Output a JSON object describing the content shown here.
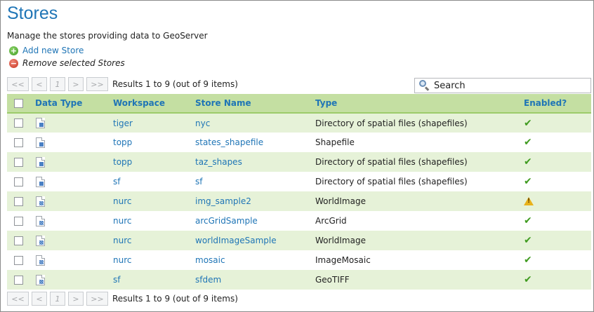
{
  "page": {
    "title": "Stores",
    "description": "Manage the stores providing data to GeoServer",
    "add_store_label": "Add new Store",
    "remove_stores_label": "Remove selected Stores"
  },
  "pager": {
    "first": "<<",
    "prev": "<",
    "current": "1",
    "next": ">",
    "last": ">>",
    "results": "Results 1 to 9 (out of 9 items)"
  },
  "search": {
    "placeholder": "Search"
  },
  "table": {
    "headers": {
      "data_type": "Data Type",
      "workspace": "Workspace",
      "store_name": "Store Name",
      "type": "Type",
      "enabled": "Enabled?"
    },
    "rows": [
      {
        "data_type": "vector",
        "workspace": "tiger",
        "store_name": "nyc",
        "type": "Directory of spatial files (shapefiles)",
        "enabled": "enabled"
      },
      {
        "data_type": "vector",
        "workspace": "topp",
        "store_name": "states_shapefile",
        "type": "Shapefile",
        "enabled": "enabled"
      },
      {
        "data_type": "vector",
        "workspace": "topp",
        "store_name": "taz_shapes",
        "type": "Directory of spatial files (shapefiles)",
        "enabled": "enabled"
      },
      {
        "data_type": "vector",
        "workspace": "sf",
        "store_name": "sf",
        "type": "Directory of spatial files (shapefiles)",
        "enabled": "enabled"
      },
      {
        "data_type": "raster",
        "workspace": "nurc",
        "store_name": "img_sample2",
        "type": "WorldImage",
        "enabled": "warning"
      },
      {
        "data_type": "raster",
        "workspace": "nurc",
        "store_name": "arcGridSample",
        "type": "ArcGrid",
        "enabled": "enabled"
      },
      {
        "data_type": "raster",
        "workspace": "nurc",
        "store_name": "worldImageSample",
        "type": "WorldImage",
        "enabled": "enabled"
      },
      {
        "data_type": "raster",
        "workspace": "nurc",
        "store_name": "mosaic",
        "type": "ImageMosaic",
        "enabled": "enabled"
      },
      {
        "data_type": "raster",
        "workspace": "sf",
        "store_name": "sfdem",
        "type": "GeoTIFF",
        "enabled": "enabled"
      }
    ]
  },
  "icons": {
    "add": "add-icon",
    "remove": "remove-icon",
    "search": "search-icon",
    "vector": "vector-store-icon",
    "raster": "raster-store-icon",
    "enabled": "checkmark-icon",
    "warning": "warning-icon"
  },
  "colors": {
    "accent": "#1f75b6",
    "header_bg": "#c4dfa2",
    "row_alt_bg": "#e6f2d8",
    "enabled": "#3f9b1f",
    "warning": "#e8b21c"
  }
}
